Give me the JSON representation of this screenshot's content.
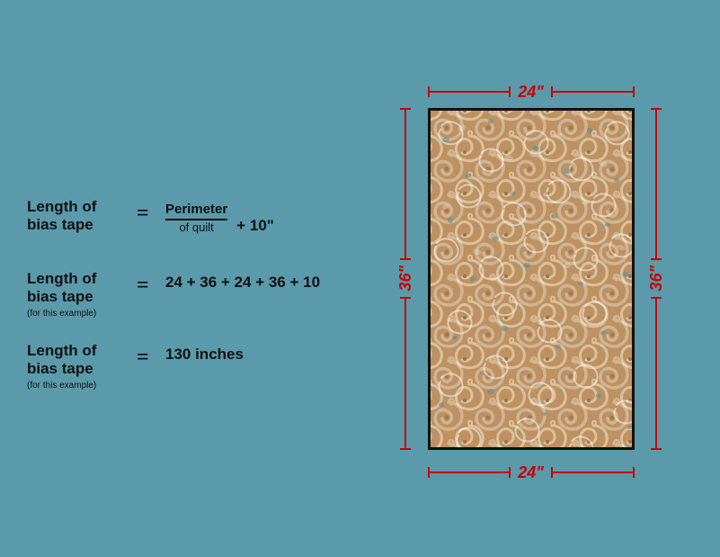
{
  "background": "#5a9aaa",
  "formulas": [
    {
      "id": "formula-1",
      "lhs_line1": "Length of",
      "lhs_line2": "bias tape",
      "lhs_sub": null,
      "rhs_type": "fraction_plus",
      "rhs_numerator": "Perimeter",
      "rhs_denominator": "of quilt",
      "rhs_extra": "+ 10\""
    },
    {
      "id": "formula-2",
      "lhs_line1": "Length of",
      "lhs_line2": "bias tape",
      "lhs_sub": "(for this example)",
      "rhs_type": "simple",
      "rhs_value": "24 + 36 + 24 + 36 + 10"
    },
    {
      "id": "formula-3",
      "lhs_line1": "Length of",
      "lhs_line2": "bias tape",
      "lhs_sub": "(for this example)",
      "rhs_type": "simple",
      "rhs_value": "130 inches"
    }
  ],
  "quilt": {
    "top_label": "24\"",
    "bottom_label": "24\"",
    "left_label": "36\"",
    "right_label": "36\""
  }
}
